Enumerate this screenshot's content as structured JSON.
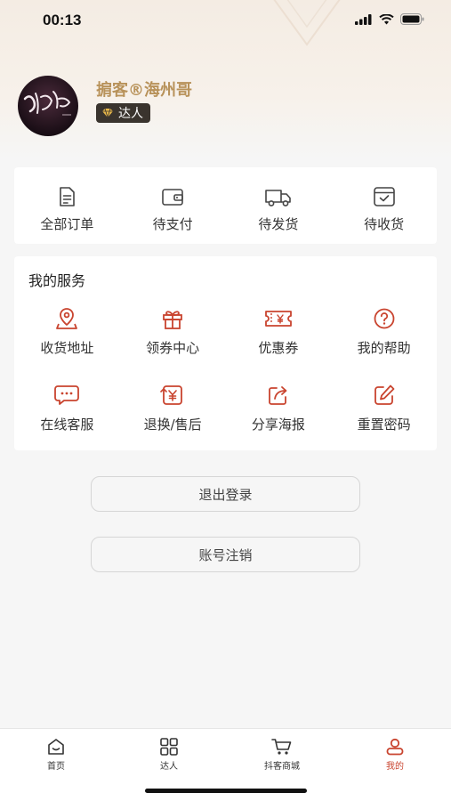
{
  "status_bar": {
    "time": "00:13"
  },
  "profile": {
    "username": "掮客®海州哥",
    "badge_label": "达人",
    "avatar_icon": "avatar-calligraphy-image"
  },
  "orders": [
    {
      "label": "全部订单",
      "icon": "document-icon"
    },
    {
      "label": "待支付",
      "icon": "wallet-icon"
    },
    {
      "label": "待发货",
      "icon": "truck-icon"
    },
    {
      "label": "待收货",
      "icon": "box-check-icon"
    }
  ],
  "services": {
    "title": "我的服务",
    "items": [
      {
        "label": "收货地址",
        "icon": "location-icon"
      },
      {
        "label": "领券中心",
        "icon": "gift-icon"
      },
      {
        "label": "优惠券",
        "icon": "coupon-icon"
      },
      {
        "label": "我的帮助",
        "icon": "help-icon"
      },
      {
        "label": "在线客服",
        "icon": "chat-icon"
      },
      {
        "label": "退换/售后",
        "icon": "refund-icon"
      },
      {
        "label": "分享海报",
        "icon": "share-icon"
      },
      {
        "label": "重置密码",
        "icon": "edit-icon"
      }
    ]
  },
  "buttons": {
    "logout": "退出登录",
    "cancel_account": "账号注销"
  },
  "tabbar": [
    {
      "label": "首页",
      "icon": "home-icon",
      "active": false
    },
    {
      "label": "达人",
      "icon": "grid-icon",
      "active": false
    },
    {
      "label": "抖客商城",
      "icon": "cart-icon",
      "active": false
    },
    {
      "label": "我的",
      "icon": "user-icon",
      "active": true
    }
  ],
  "colors": {
    "accent": "#c9442f",
    "gold": "#b8925a",
    "badge_bg": "#3a342e"
  }
}
